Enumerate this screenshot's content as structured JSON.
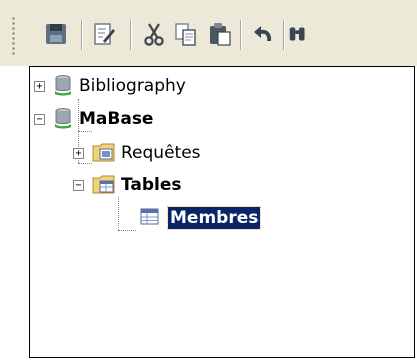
{
  "toolbar": {
    "buttons": [
      {
        "name": "save-button",
        "icon": "save-icon"
      },
      {
        "name": "edit-button",
        "icon": "edit-icon"
      },
      {
        "name": "cut-button",
        "icon": "cut-icon"
      },
      {
        "name": "copy-button",
        "icon": "copy-icon"
      },
      {
        "name": "paste-button",
        "icon": "paste-icon"
      },
      {
        "name": "undo-button",
        "icon": "undo-icon"
      },
      {
        "name": "binoculars-button",
        "icon": "binoculars-icon"
      }
    ]
  },
  "tree": {
    "nodes": [
      {
        "label": "Bibliography",
        "icon": "database-icon",
        "expander": "+"
      },
      {
        "label": "MaBase",
        "icon": "database-icon",
        "expander": "−"
      },
      {
        "label": "Requêtes",
        "icon": "queries-folder-icon",
        "expander": "+"
      },
      {
        "label": "Tables",
        "icon": "tables-folder-icon",
        "expander": "−"
      },
      {
        "label": "Membres",
        "icon": "table-icon",
        "selected": true
      }
    ]
  },
  "colors": {
    "toolbar_bg": "#ece9d8",
    "selection_bg": "#0a246a",
    "selection_text": "#ffffff"
  }
}
